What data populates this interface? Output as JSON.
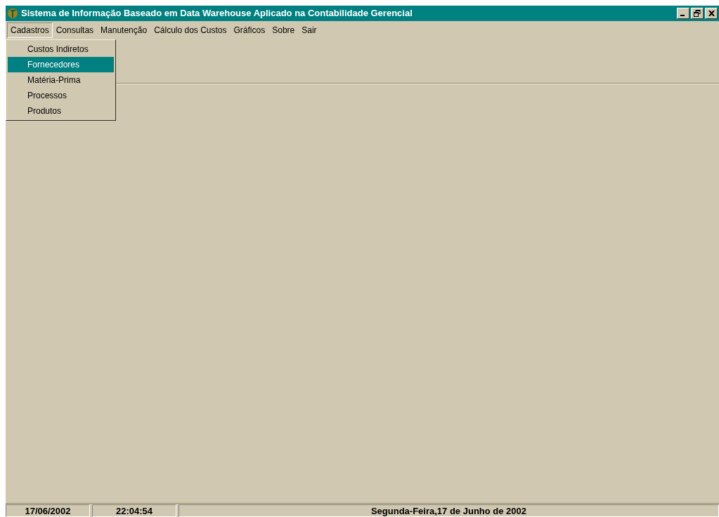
{
  "window": {
    "title": "Sistema de Informação Baseado em Data Warehouse Aplicado na Contabilidade Gerencial"
  },
  "menu_bar": [
    {
      "label": "Cadastros",
      "selected": true
    },
    {
      "label": "Consultas",
      "selected": false
    },
    {
      "label": "Manutenção",
      "selected": false
    },
    {
      "label": "Cálculo dos Custos",
      "selected": false
    },
    {
      "label": "Gráficos",
      "selected": false
    },
    {
      "label": "Sobre",
      "selected": false
    },
    {
      "label": "Sair",
      "selected": false
    }
  ],
  "dropdown": [
    {
      "label": "Custos Indiretos",
      "selected": false
    },
    {
      "label": "Fornecedores",
      "selected": true
    },
    {
      "label": "Matéria-Prima",
      "selected": false
    },
    {
      "label": "Processos",
      "selected": false
    },
    {
      "label": "Produtos",
      "selected": false
    }
  ],
  "status_bar": [
    "17/06/2002",
    "22:04:54",
    "Segunda-Feira,17 de Junho de 2002"
  ]
}
